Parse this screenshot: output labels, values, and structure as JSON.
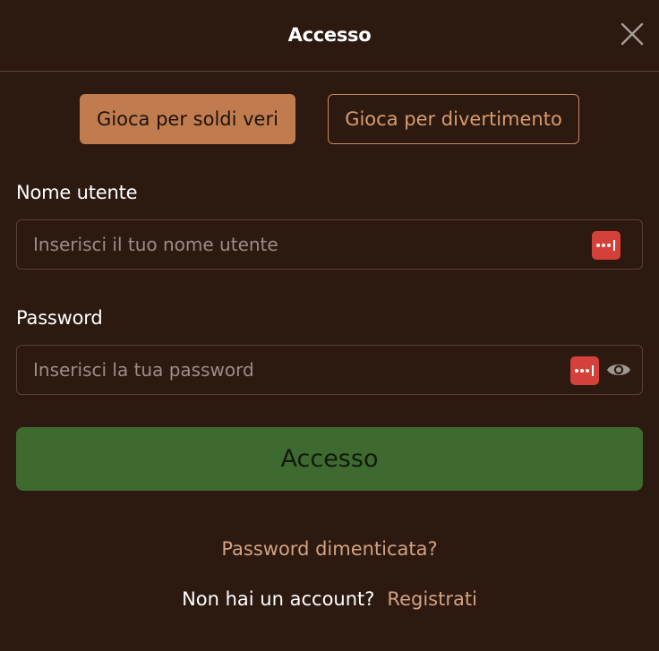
{
  "header": {
    "title": "Accesso",
    "close_icon": "close-icon"
  },
  "mode_toggle": {
    "real_money_label": "Gioca per soldi veri",
    "for_fun_label": "Gioca per divertimento",
    "selected": "real_money"
  },
  "username": {
    "label": "Nome utente",
    "placeholder": "Inserisci il tuo nome utente",
    "value": "",
    "icon": "password-manager-icon"
  },
  "password": {
    "label": "Password",
    "placeholder": "Inserisci la tua password",
    "value": "",
    "icons": [
      "password-manager-icon",
      "eye-icon"
    ]
  },
  "submit": {
    "label": "Accesso"
  },
  "forgot_password": {
    "label": "Password dimenticata?"
  },
  "signup": {
    "prompt": "Non hai un account?",
    "link_label": "Registrati"
  },
  "colors": {
    "background": "#2c1910",
    "accent": "#c07c4f",
    "submit_green": "#3f6a2f",
    "link": "#d4a280",
    "password_manager_red": "#d4403a"
  }
}
